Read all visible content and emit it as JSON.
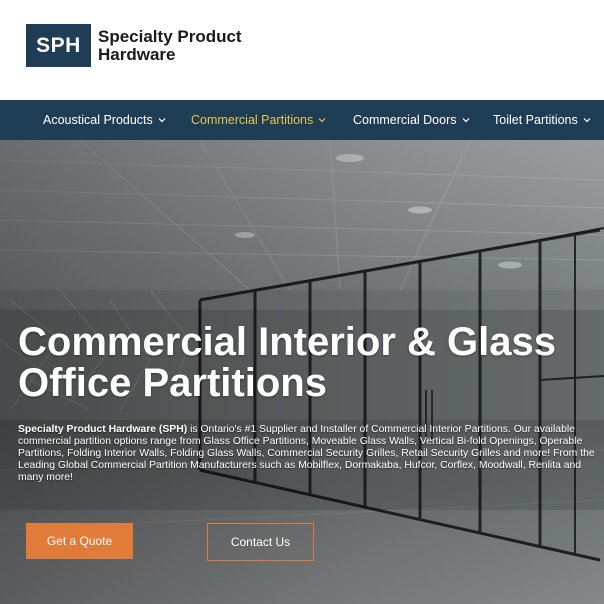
{
  "brand": {
    "logo_mark": "SPH",
    "name_line1": "Specialty Product",
    "name_line2": "Hardware",
    "color_primary": "#1f3d55",
    "color_accent": "#e07b3a",
    "color_nav_active": "#e8c547"
  },
  "nav": {
    "items": [
      {
        "label": "Acoustical Products",
        "icon": "chevron-down-icon",
        "active": false
      },
      {
        "label": "Commercial Partitions",
        "icon": "chevron-down-icon",
        "active": true
      },
      {
        "label": "Commercial Doors",
        "icon": "chevron-down-icon",
        "active": false
      },
      {
        "label": "Toilet Partitions",
        "icon": "chevron-down-icon",
        "active": false
      }
    ]
  },
  "hero": {
    "title_line1": "Commercial Interior & Glass",
    "title_line2": "Office Partitions",
    "body_bold": "Specialty Product Hardware (SPH)",
    "body_text": " is Ontario's #1 Supplier and Installer of Commercial Interior Partitions. Our available commercial partition options range from Glass Office Partitions, Moveable Glass Walls, Vertical Bi-fold Openings, Operable Partitions, Folding Interior Walls, Folding Glass Walls, Commercial Security Grilles, Retail Security Grilles and more! From the Leading Global Commercial Partition Manufacturers such as Mobilflex, Dormakaba, Hufcor, Corflex, Moodwall, Renlita and many more!",
    "cta_primary": "Get a Quote",
    "cta_secondary": "Contact Us"
  }
}
